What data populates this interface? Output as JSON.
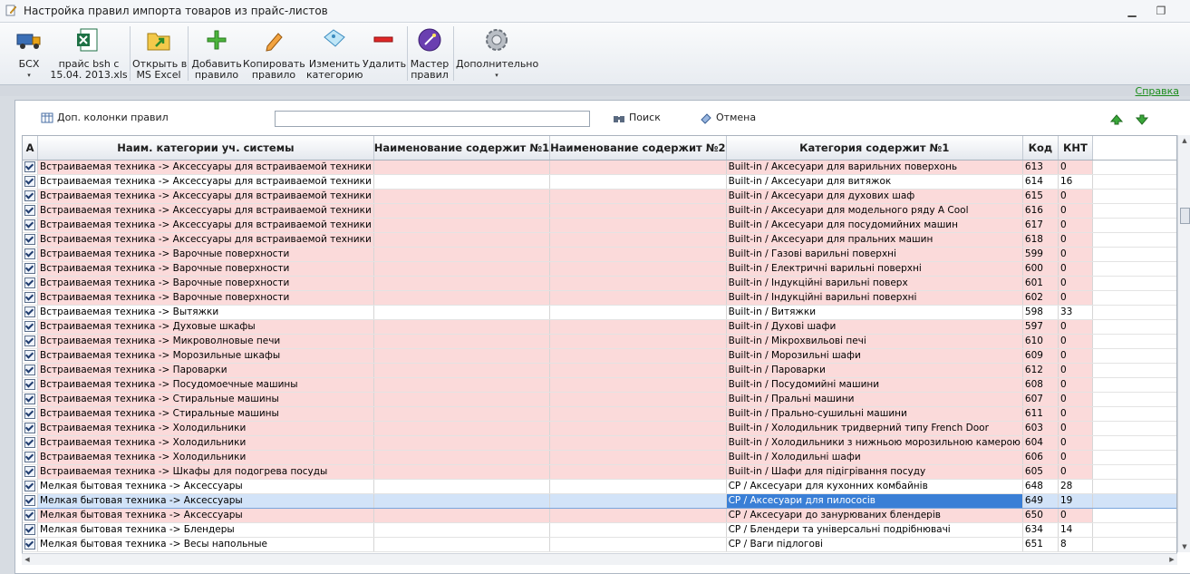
{
  "window": {
    "title": "Настройка правил импорта товаров из прайс-листов"
  },
  "ribbon": {
    "buttons": [
      {
        "label": "БСХ",
        "has_dropdown": true
      },
      {
        "label": "прайс bsh с\n15.04. 2013.xls",
        "has_dropdown": true
      },
      {
        "label": "Открыть в\nMS Excel"
      },
      {
        "label": "Добавить\nправило"
      },
      {
        "label": "Копировать\nправило"
      },
      {
        "label": "Изменить\nкатегорию"
      },
      {
        "label": "Удалить"
      },
      {
        "label": "Мастер\nправил"
      },
      {
        "label": "Дополнительно",
        "has_dropdown": true
      }
    ],
    "caret": "▾"
  },
  "help_link": "Справка",
  "toolbar": {
    "extra_columns": "Доп. колонки правил",
    "search_value": "",
    "search_button": "Поиск",
    "cancel_button": "Отмена"
  },
  "table": {
    "columns": [
      "А",
      "Наим. категории уч. системы",
      "Наименование содержит №1",
      "Наименование содержит №2",
      "Категория содержит №1",
      "Код",
      "КНТ"
    ],
    "rows": [
      {
        "checked": true,
        "cat": "Встраиваемая техника -> Аксессуары для встраиваемой техники",
        "n1": "",
        "n2": "",
        "c1": "Built-in / Аксесуари для варильних поверхонь",
        "code": "613",
        "knt": "0",
        "style": "pink"
      },
      {
        "checked": true,
        "cat": "Встраиваемая техника -> Аксессуары для встраиваемой техники",
        "n1": "",
        "n2": "",
        "c1": "Built-in / Аксесуари для витяжок",
        "code": "614",
        "knt": "16",
        "style": "white"
      },
      {
        "checked": true,
        "cat": "Встраиваемая техника -> Аксессуары для встраиваемой техники",
        "n1": "",
        "n2": "",
        "c1": "Built-in / Аксесуари для духових шаф",
        "code": "615",
        "knt": "0",
        "style": "pink"
      },
      {
        "checked": true,
        "cat": "Встраиваемая техника -> Аксессуары для встраиваемой техники",
        "n1": "",
        "n2": "",
        "c1": "Built-in / Аксесуари для модельного ряду A Cool",
        "code": "616",
        "knt": "0",
        "style": "pink"
      },
      {
        "checked": true,
        "cat": "Встраиваемая техника -> Аксессуары для встраиваемой техники",
        "n1": "",
        "n2": "",
        "c1": "Built-in / Аксесуари для посудомийних машин",
        "code": "617",
        "knt": "0",
        "style": "pink"
      },
      {
        "checked": true,
        "cat": "Встраиваемая техника -> Аксессуары для встраиваемой техники",
        "n1": "",
        "n2": "",
        "c1": "Built-in / Аксесуари для пральних машин",
        "code": "618",
        "knt": "0",
        "style": "pink"
      },
      {
        "checked": true,
        "cat": "Встраиваемая техника -> Варочные поверхности",
        "n1": "",
        "n2": "",
        "c1": "Built-in / Газові варильні поверхні",
        "code": "599",
        "knt": "0",
        "style": "pink"
      },
      {
        "checked": true,
        "cat": "Встраиваемая техника -> Варочные поверхности",
        "n1": "",
        "n2": "",
        "c1": "Built-in / Електричні варильні поверхні",
        "code": "600",
        "knt": "0",
        "style": "pink"
      },
      {
        "checked": true,
        "cat": "Встраиваемая техника -> Варочные поверхности",
        "n1": "",
        "n2": "",
        "c1": "Built-in / Індукційні варильні поверх",
        "code": "601",
        "knt": "0",
        "style": "pink"
      },
      {
        "checked": true,
        "cat": "Встраиваемая техника -> Варочные поверхности",
        "n1": "",
        "n2": "",
        "c1": "Built-in / Індукційні варильні поверхні",
        "code": "602",
        "knt": "0",
        "style": "pink"
      },
      {
        "checked": true,
        "cat": "Встраиваемая техника -> Вытяжки",
        "n1": "",
        "n2": "",
        "c1": "Built-in / Витяжки",
        "code": "598",
        "knt": "33",
        "style": "white"
      },
      {
        "checked": true,
        "cat": "Встраиваемая техника -> Духовые шкафы",
        "n1": "",
        "n2": "",
        "c1": "Built-in / Духові шафи",
        "code": "597",
        "knt": "0",
        "style": "pink"
      },
      {
        "checked": true,
        "cat": "Встраиваемая техника -> Микроволновые печи",
        "n1": "",
        "n2": "",
        "c1": "Built-in / Мікрохвильові печі",
        "code": "610",
        "knt": "0",
        "style": "pink"
      },
      {
        "checked": true,
        "cat": "Встраиваемая техника -> Морозильные шкафы",
        "n1": "",
        "n2": "",
        "c1": "Built-in / Морозильні шафи",
        "code": "609",
        "knt": "0",
        "style": "pink"
      },
      {
        "checked": true,
        "cat": "Встраиваемая техника -> Пароварки",
        "n1": "",
        "n2": "",
        "c1": "Built-in / Пароварки",
        "code": "612",
        "knt": "0",
        "style": "pink"
      },
      {
        "checked": true,
        "cat": "Встраиваемая техника -> Посудомоечные машины",
        "n1": "",
        "n2": "",
        "c1": "Built-in / Посудомийні машини",
        "code": "608",
        "knt": "0",
        "style": "pink"
      },
      {
        "checked": true,
        "cat": "Встраиваемая техника -> Стиральные машины",
        "n1": "",
        "n2": "",
        "c1": "Built-in / Пральні машини",
        "code": "607",
        "knt": "0",
        "style": "pink"
      },
      {
        "checked": true,
        "cat": "Встраиваемая техника -> Стиральные машины",
        "n1": "",
        "n2": "",
        "c1": "Built-in / Прально-сушильні машини",
        "code": "611",
        "knt": "0",
        "style": "pink"
      },
      {
        "checked": true,
        "cat": "Встраиваемая техника -> Холодильники",
        "n1": "",
        "n2": "",
        "c1": "Built-in / Холодильник тридверний типу French Door",
        "code": "603",
        "knt": "0",
        "style": "pink"
      },
      {
        "checked": true,
        "cat": "Встраиваемая техника -> Холодильники",
        "n1": "",
        "n2": "",
        "c1": "Built-in / Холодильники з нижньою морозильною камерою",
        "code": "604",
        "knt": "0",
        "style": "pink"
      },
      {
        "checked": true,
        "cat": "Встраиваемая техника -> Холодильники",
        "n1": "",
        "n2": "",
        "c1": "Built-in / Холодильні шафи",
        "code": "606",
        "knt": "0",
        "style": "pink"
      },
      {
        "checked": true,
        "cat": "Встраиваемая техника -> Шкафы для подогрева посуды",
        "n1": "",
        "n2": "",
        "c1": "Built-in / Шафи для підігрівання посуду",
        "code": "605",
        "knt": "0",
        "style": "pink"
      },
      {
        "checked": true,
        "cat": "Мелкая бытовая техника -> Аксессуары",
        "n1": "",
        "n2": "",
        "c1": "CP / Аксесуари для кухонних комбайнів",
        "code": "648",
        "knt": "28",
        "style": "white"
      },
      {
        "checked": true,
        "cat": "Мелкая бытовая техника -> Аксессуары",
        "n1": "",
        "n2": "",
        "c1": "CP / Аксесуари для пилососів",
        "code": "649",
        "knt": "19",
        "style": "sel"
      },
      {
        "checked": true,
        "cat": "Мелкая бытовая техника -> Аксессуары",
        "n1": "",
        "n2": "",
        "c1": "CP / Аксесуари до занурюваних блендерів",
        "code": "650",
        "knt": "0",
        "style": "pink"
      },
      {
        "checked": true,
        "cat": "Мелкая бытовая техника -> Блендеры",
        "n1": "",
        "n2": "",
        "c1": "CP / Блендери та універсальні подрібнювачі",
        "code": "634",
        "knt": "14",
        "style": "white"
      },
      {
        "checked": true,
        "cat": "Мелкая бытовая техника -> Весы напольные",
        "n1": "",
        "n2": "",
        "c1": "CP / Ваги підлогові",
        "code": "651",
        "knt": "8",
        "style": "white"
      }
    ]
  },
  "colors": {
    "row_pink": "#fbdada",
    "row_selected": "#d2e3f8",
    "cell_focus": "#3a7fd6",
    "help_link": "#1a8c1a"
  }
}
